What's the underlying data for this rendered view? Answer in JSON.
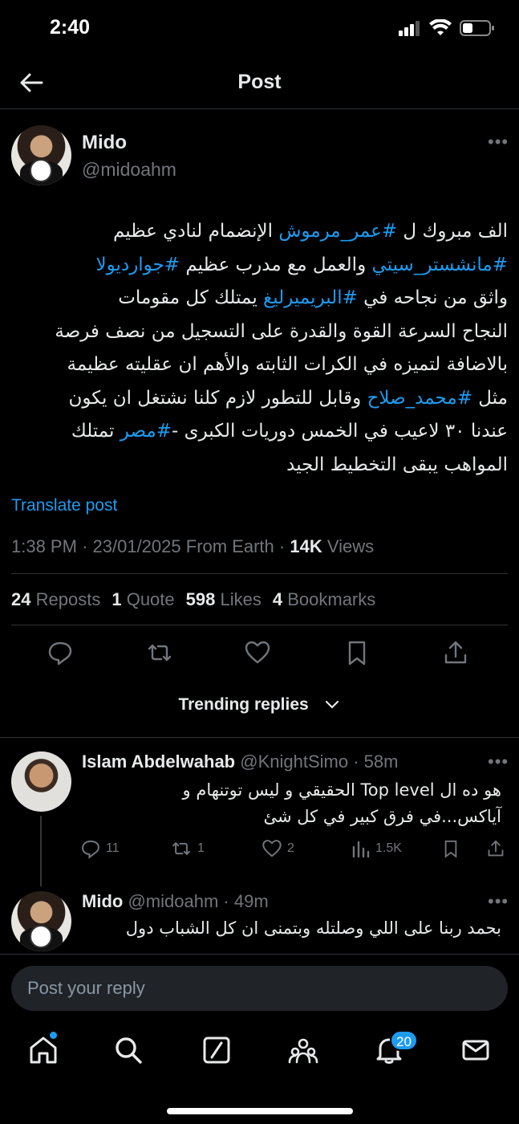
{
  "status_bar": {
    "time": "2:40"
  },
  "nav": {
    "title": "Post"
  },
  "post": {
    "author_name": "Mido",
    "author_handle": "@midoahm",
    "lines": [
      [
        {
          "t": "الف مبروك ل "
        },
        {
          "t": "#عمر_مرموش",
          "link": true
        },
        {
          "t": " الإنضمام لنادي عظيم"
        }
      ],
      [
        {
          "t": "#مانشستر_سيتي",
          "link": true
        },
        {
          "t": " والعمل مع مدرب عظيم "
        },
        {
          "t": "#جوارديولا",
          "link": true
        }
      ],
      [
        {
          "t": "واثق من نجاحه في "
        },
        {
          "t": "#البريميرليغ",
          "link": true
        },
        {
          "t": " يمتلك كل مقومات"
        }
      ],
      [
        {
          "t": "النجاح السرعة القوة والقدرة على التسجيل من نصف فرصة"
        }
      ],
      [
        {
          "t": "بالاضافة لتميزه في الكرات الثابته والأهم ان عقليته عظيمة"
        }
      ],
      [
        {
          "t": "مثل "
        },
        {
          "t": "#محمد_صلاح",
          "link": true
        },
        {
          "t": " وقابل للتطور لازم كلنا نشتغل ان يكون"
        }
      ],
      [
        {
          "t": "عندنا ٣٠ لاعيب في الخمس دوريات الكبرى -"
        },
        {
          "t": "#مصر",
          "link": true
        },
        {
          "t": " تمتلك"
        }
      ],
      [
        {
          "t": "المواهب يبقى التخطيط الجيد"
        }
      ]
    ],
    "translate_label": "Translate post",
    "meta": {
      "time": "1:38 PM",
      "date": "23/01/2025",
      "source": "From Earth",
      "views_count": "14K",
      "views_label": "Views"
    },
    "stats": {
      "reposts_count": "24",
      "reposts_label": "Reposts",
      "quotes_count": "1",
      "quotes_label": "Quote",
      "likes_count": "598",
      "likes_label": "Likes",
      "bookmarks_count": "4",
      "bookmarks_label": "Bookmarks"
    }
  },
  "trending_label": "Trending replies",
  "replies": [
    {
      "name": "Islam Abdelwahab",
      "handle": "@KnightSimo",
      "time": "58m",
      "lines": [
        "هو ده ال Top level الحقيقي و ليس توتنهام و",
        "آياكس...في فرق كبير في كل شئ"
      ],
      "replies": "11",
      "reposts": "1",
      "likes": "2",
      "views": "1.5K"
    },
    {
      "name": "Mido",
      "handle": "@midoahm",
      "time": "49m",
      "lines": [
        "بحمد ربنا على اللي وصلتله وبتمنى ان كل الشباب دول"
      ]
    }
  ],
  "composer": {
    "placeholder": "Post your reply"
  },
  "tabbar": {
    "notifications_badge": "20"
  },
  "colors": {
    "accent": "#1d9bf0",
    "background": "#000000",
    "muted": "#71767b"
  }
}
